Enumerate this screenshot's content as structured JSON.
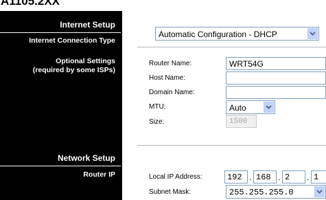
{
  "partial_header": "A1105.2XX",
  "sidebar": {
    "internet_setup": "Internet Setup",
    "connection_type": "Internet Connection Type",
    "optional_settings": "Optional Settings",
    "optional_note": "(required by some ISPs)",
    "network_setup": "Network Setup",
    "router_ip": "Router IP"
  },
  "connection_type_select": {
    "value": "Automatic Configuration - DHCP"
  },
  "optional": {
    "router_name_label": "Router Name:",
    "router_name_value": "WRT54G",
    "host_name_label": "Host Name:",
    "host_name_value": "",
    "domain_name_label": "Domain Name:",
    "domain_name_value": "",
    "mtu_label": "MTU:",
    "mtu_value": "Auto",
    "size_label": "Size:",
    "size_value": "1500"
  },
  "router_ip": {
    "local_ip_label": "Local IP Address:",
    "octets": [
      "192",
      "168",
      "2",
      "1"
    ],
    "subnet_label": "Subnet Mask:",
    "subnet_value": "255.255.255.0"
  }
}
